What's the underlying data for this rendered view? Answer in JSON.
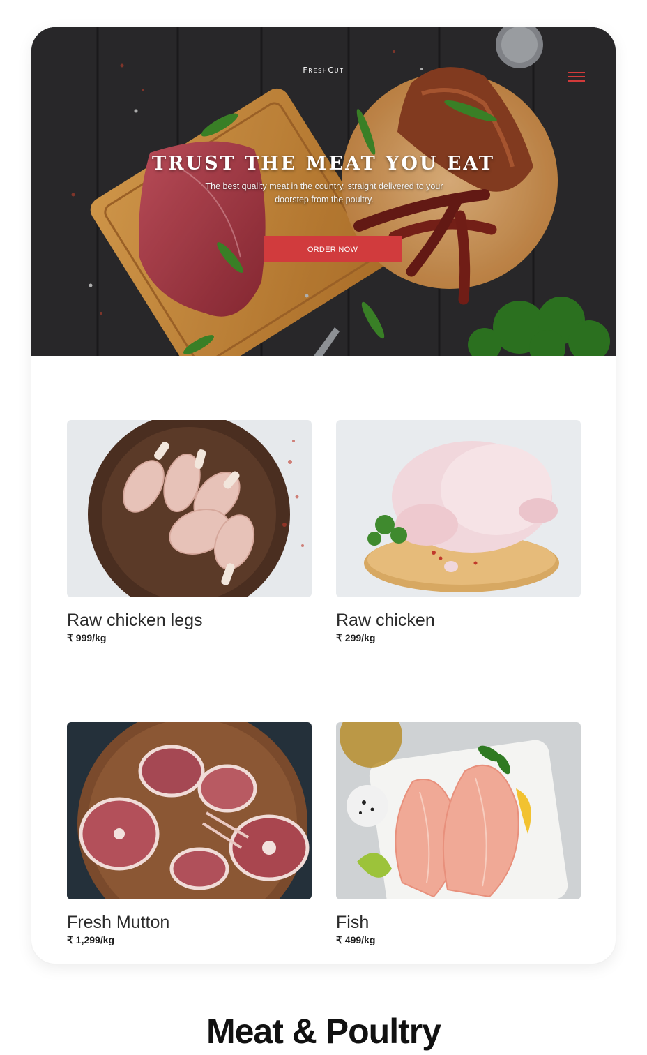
{
  "app": {
    "brand": "FreshCut"
  },
  "hero": {
    "title": "TRUST THE MEAT YOU EAT",
    "subtitle": "The best quality meat in the country, straight delivered to your doorstep from the poultry.",
    "cta_label": "ORDER NOW",
    "accent_color": "#d13b3d"
  },
  "products": [
    {
      "name": "Raw chicken legs",
      "price": "₹ 999/kg"
    },
    {
      "name": "Raw chicken",
      "price": "₹ 299/kg"
    },
    {
      "name": "Fresh Mutton",
      "price": "₹ 1,299/kg"
    },
    {
      "name": "Fish",
      "price": "₹ 499/kg"
    }
  ],
  "section": {
    "title": "Meat & Poultry"
  },
  "icons": {
    "menu": "hamburger-menu-icon"
  }
}
